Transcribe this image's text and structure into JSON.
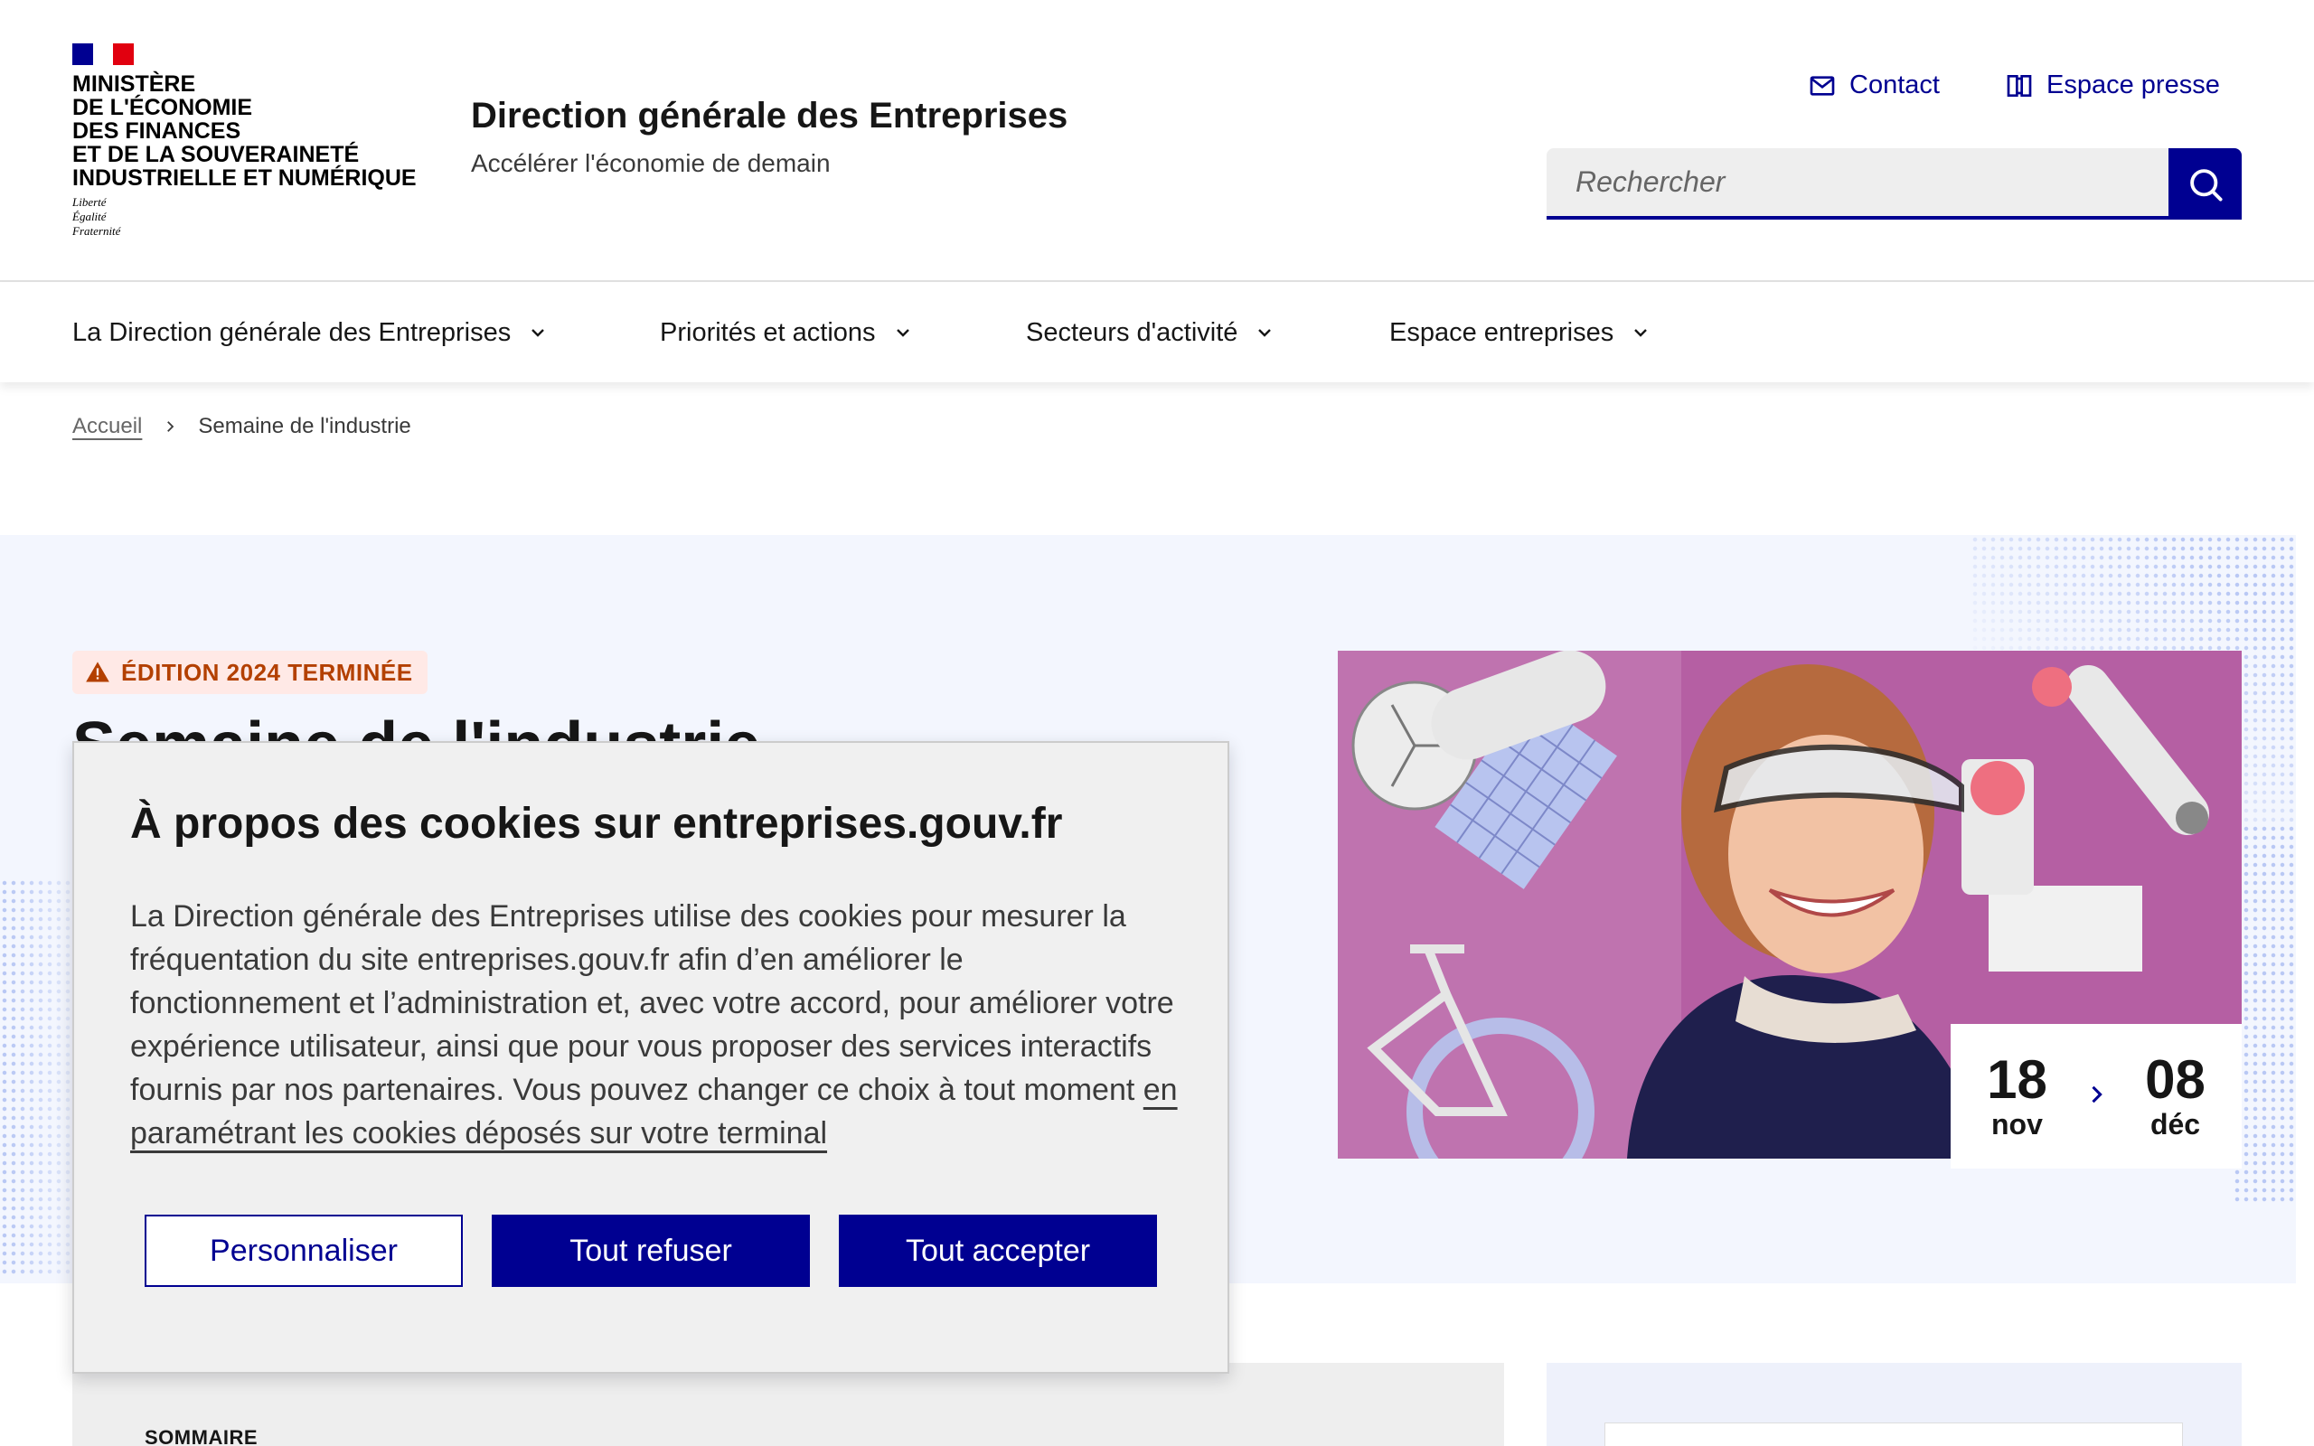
{
  "header": {
    "ministry_lines": [
      "Ministère",
      "de l'économie",
      "des finances",
      "et de la souveraineté",
      "industrielle et numérique"
    ],
    "motto_lines": [
      "Liberté",
      "Égalité",
      "Fraternité"
    ],
    "service_title": "Direction générale des Entreprises",
    "service_tagline": "Accélérer l'économie de demain",
    "tools": {
      "contact_label": "Contact",
      "presse_label": "Espace presse"
    },
    "search": {
      "placeholder": "Rechercher",
      "value": ""
    }
  },
  "nav": {
    "items": [
      {
        "label": "La Direction générale des Entreprises"
      },
      {
        "label": "Priorités et actions"
      },
      {
        "label": "Secteurs d'activité"
      },
      {
        "label": "Espace entreprises"
      }
    ]
  },
  "breadcrumb": {
    "home": "Accueil",
    "current": "Semaine de l'industrie"
  },
  "hero": {
    "badge": "Édition 2024 terminée",
    "title": "Semaine de l'industrie",
    "dates": {
      "start_day": "18",
      "start_month": "nov",
      "end_day": "08",
      "end_month": "déc"
    }
  },
  "summary": {
    "label": "Sommaire"
  },
  "cookie": {
    "title": "À propos des cookies sur entreprises.gouv.fr",
    "text": "La Direction générale des Entreprises utilise des cookies pour mesurer la fréquentation du site entreprises.gouv.fr afin d’en améliorer le fonctionnement et l’administration et, avec votre accord, pour améliorer votre expérience utilisateur, ainsi que pour vous proposer des services interactifs fournis par nos partenaires. Vous pouvez changer ce choix à tout moment ",
    "link": "en paramétrant les cookies déposés sur votre terminal",
    "buttons": {
      "customize": "Personnaliser",
      "refuse": "Tout refuser",
      "accept": "Tout accepter"
    }
  },
  "colors": {
    "primary_blue": "#000091",
    "warning_text": "#b34000",
    "warning_bg": "#ffe9e6",
    "hero_bg": "#f3f6fe"
  },
  "icons": [
    "mail-icon",
    "book-icon",
    "search-icon",
    "chevron-down-icon",
    "chevron-right-icon",
    "warning-icon"
  ]
}
